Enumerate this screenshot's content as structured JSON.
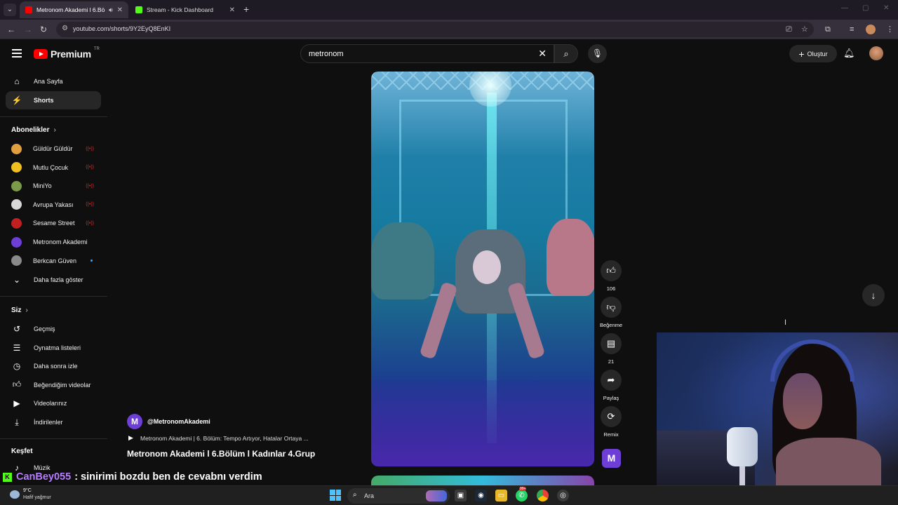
{
  "browser": {
    "tabs": [
      {
        "title": "Metronom Akademi l 6.Bö",
        "active": true,
        "favicon_color": "#ff0000"
      },
      {
        "title": "Stream - Kick Dashboard",
        "active": false,
        "favicon_color": "#53fc18"
      }
    ],
    "url": "youtube.com/shorts/9Y2EyQ8EnKI"
  },
  "header": {
    "logo_text": "Premium",
    "logo_country": "TR",
    "search_value": "metronom",
    "create_label": "Oluştur"
  },
  "sidebar": {
    "main_items": [
      {
        "label": "Ana Sayfa",
        "icon": "home-icon"
      },
      {
        "label": "Shorts",
        "icon": "shorts-icon",
        "active": true
      }
    ],
    "subs_heading": "Abonelikler",
    "subscriptions": [
      {
        "label": "Güldür Güldür",
        "status": "live",
        "color": "#e0a040"
      },
      {
        "label": "Mutlu Çocuk",
        "status": "live",
        "color": "#f0c020"
      },
      {
        "label": "MiniYo",
        "status": "live",
        "color": "#7a9a4a"
      },
      {
        "label": "Avrupa Yakası",
        "status": "live",
        "color": "#d8d8d8"
      },
      {
        "label": "Sesame Street",
        "status": "live",
        "color": "#c02020"
      },
      {
        "label": "Metronom Akademi",
        "status": "none",
        "color": "#6d3fd6"
      },
      {
        "label": "Berkcan Güven",
        "status": "new",
        "color": "#8a8a8a"
      }
    ],
    "show_more_label": "Daha fazla göster",
    "you_heading": "Siz",
    "you_items": [
      {
        "label": "Geçmiş",
        "icon": "history-icon"
      },
      {
        "label": "Oynatma listeleri",
        "icon": "playlist-icon"
      },
      {
        "label": "Daha sonra izle",
        "icon": "watch-later-icon"
      },
      {
        "label": "Beğendiğim videolar",
        "icon": "like-icon"
      },
      {
        "label": "Videolarınız",
        "icon": "your-videos-icon"
      },
      {
        "label": "İndirilenler",
        "icon": "download-icon"
      }
    ],
    "explore_heading": "Keşfet",
    "explore_items": [
      {
        "label": "Müzik",
        "icon": "music-icon"
      }
    ]
  },
  "short": {
    "channel_handle": "@MetronomAkademi",
    "channel_initial": "M",
    "playlist_text": "Metronom Akademi | 6. Bölüm: Tempo Artıyor, Hatalar Ortaya ...",
    "title": "Metronom Akademi l 6.Bölüm l Kadınlar 4.Grup",
    "actions": {
      "like_count": "106",
      "dislike_label": "Beğenme",
      "comment_count": "21",
      "share_label": "Paylaş",
      "remix_label": "Remix"
    }
  },
  "overlay": {
    "chat_user": "CanBey055",
    "chat_message": ": sinirimi bozdu ben de cevabnı verdim"
  },
  "taskbar": {
    "temperature": "9°C",
    "weather": "Hafif yağmur",
    "search_placeholder": "Ara",
    "whatsapp_badge": "99+"
  }
}
